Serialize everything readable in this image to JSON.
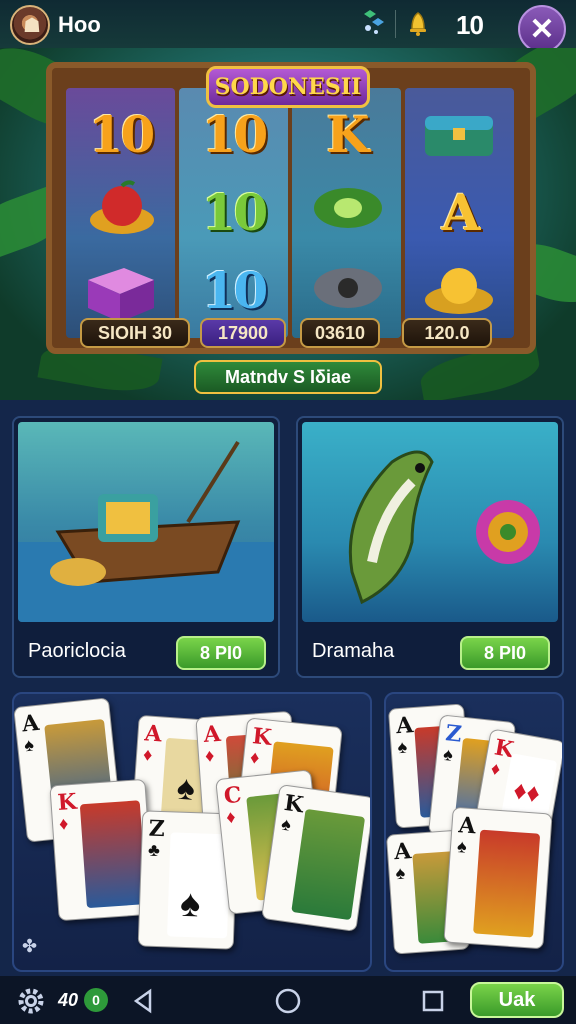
{
  "header": {
    "username": "Hoo",
    "credits": "10",
    "close_label": "✕"
  },
  "slot": {
    "title": "SODONESII",
    "reels": [
      [
        "10",
        "apple",
        "gift"
      ],
      [
        "10",
        "10",
        "10"
      ],
      [
        "K",
        "leaf",
        "eye"
      ],
      [
        "chest",
        "A",
        "coins"
      ]
    ],
    "pills": [
      "SIOIH 30",
      "17900",
      "03610",
      "120.0"
    ],
    "total_label": "Matndv S Iδiae"
  },
  "games": [
    {
      "title": "Paoriclocia",
      "button": "8 PI0"
    },
    {
      "title": "Dramaha",
      "button": "8 PI0"
    }
  ],
  "navbar": {
    "count": "40",
    "badge": "0",
    "action_label": "Uak"
  }
}
